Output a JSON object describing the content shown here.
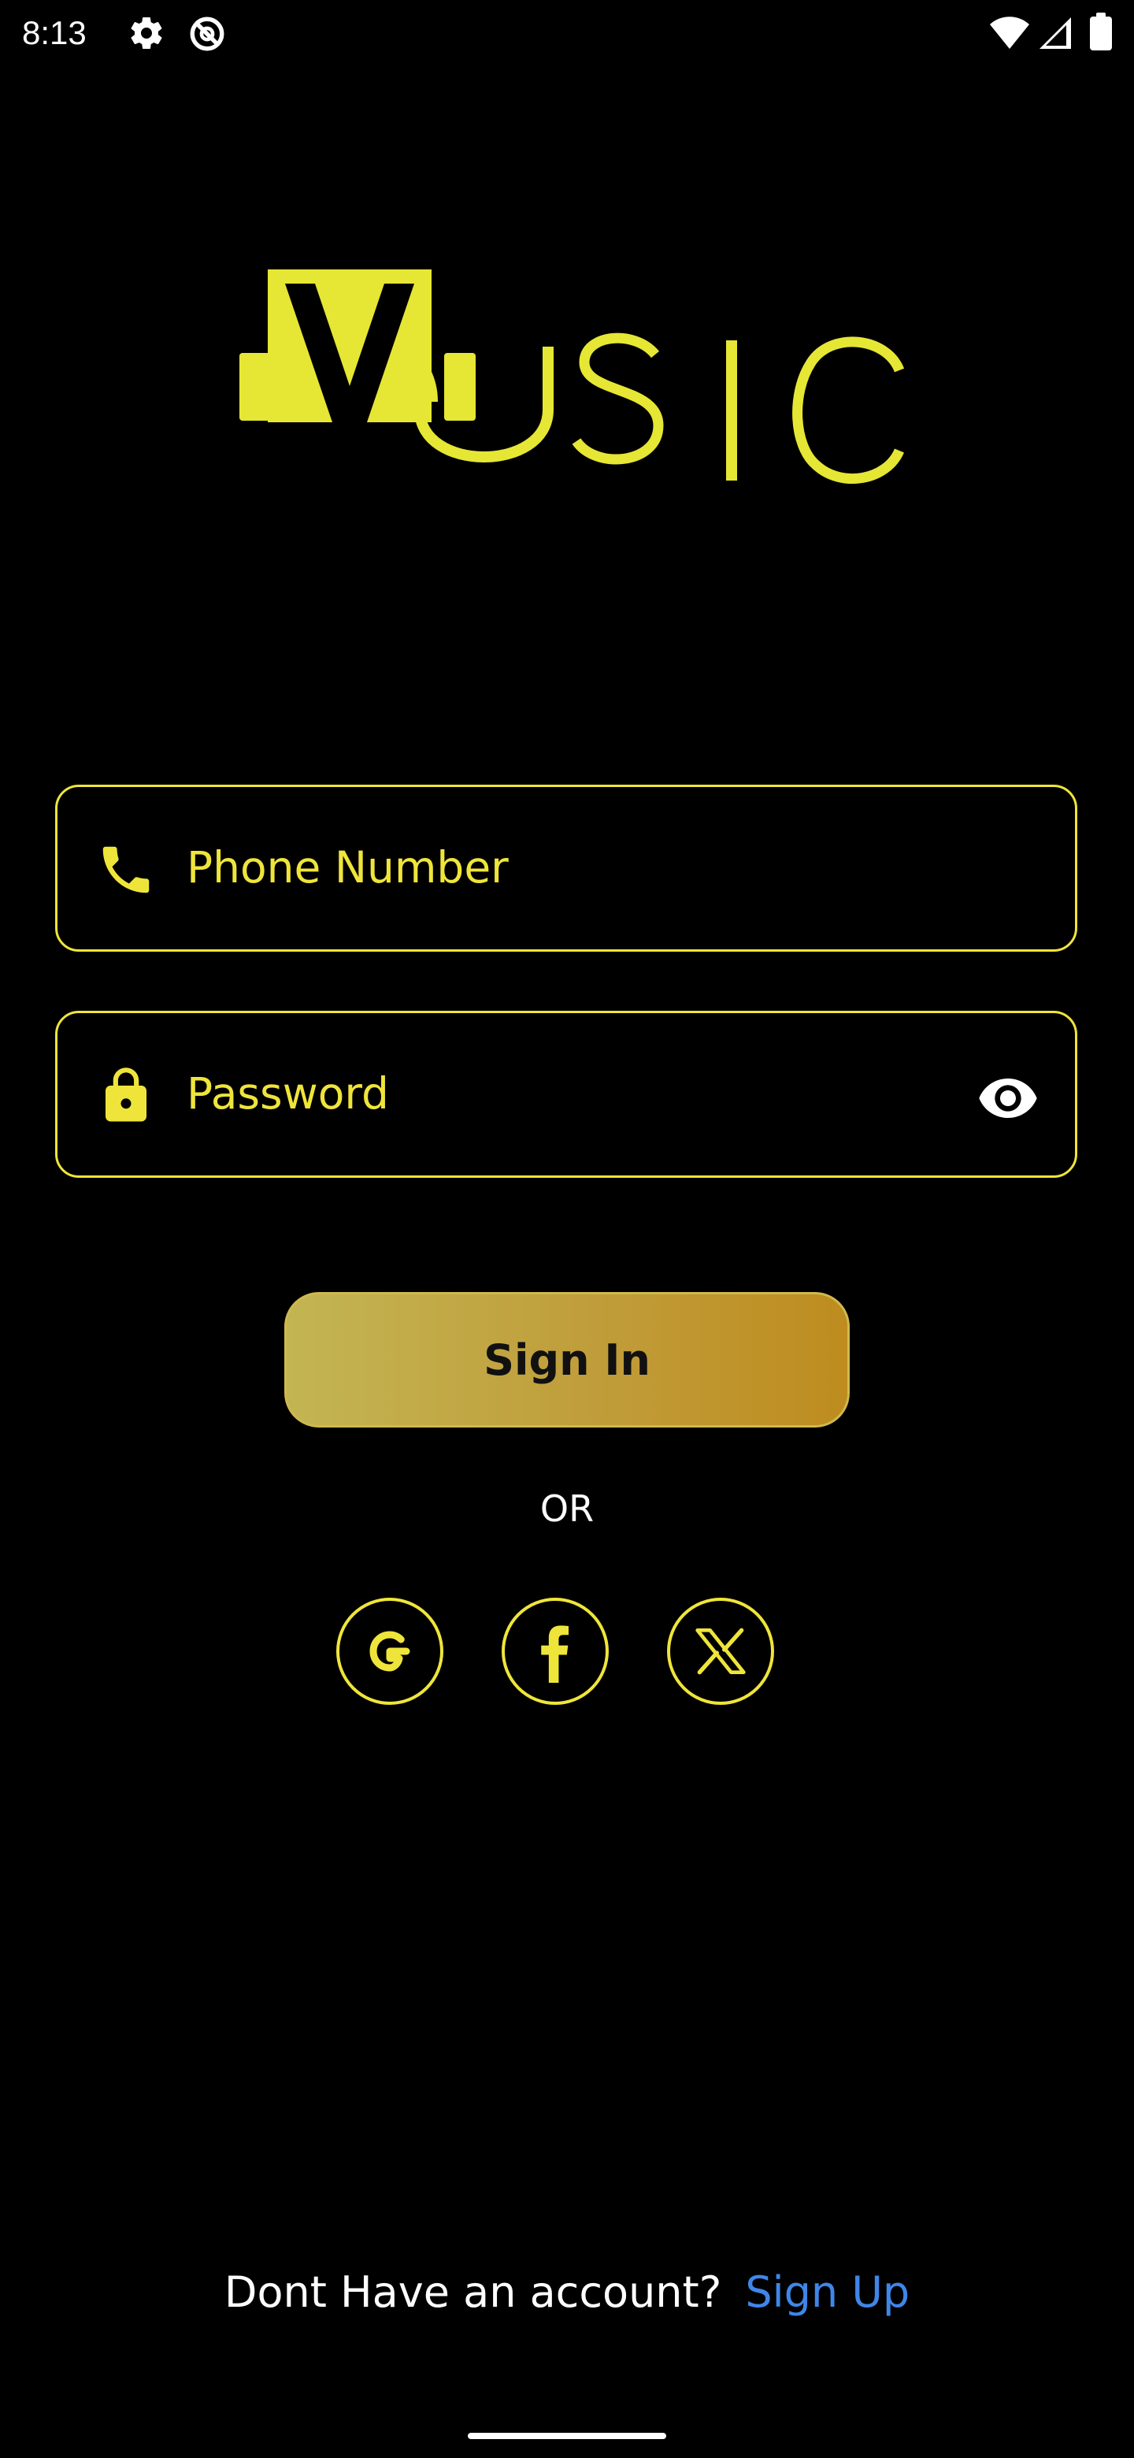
{
  "status_bar": {
    "time": "8:13",
    "icons": [
      "settings-icon",
      "do-not-disturb-icon",
      "wifi-icon",
      "cell-signal-icon",
      "battery-icon"
    ]
  },
  "logo": {
    "text": "MUSIC",
    "color": "#e6e635"
  },
  "form": {
    "phone": {
      "placeholder": "Phone Number",
      "value": "",
      "icon": "phone-icon"
    },
    "password": {
      "placeholder": "Password",
      "value": "",
      "icon": "lock-icon",
      "toggle_icon": "eye-icon"
    },
    "sign_in_label": "Sign In",
    "or_label": "OR"
  },
  "social": [
    {
      "name": "Google",
      "icon": "google-icon"
    },
    {
      "name": "Facebook",
      "icon": "facebook-icon"
    },
    {
      "name": "X",
      "icon": "x-icon"
    }
  ],
  "footer": {
    "text": "Dont Have an account?",
    "link_label": "Sign Up"
  },
  "colors": {
    "background": "#000000",
    "accent": "#efe53a",
    "link": "#3f86e8",
    "button_gradient_start": "#c3b553",
    "button_gradient_end": "#be8c1f"
  }
}
